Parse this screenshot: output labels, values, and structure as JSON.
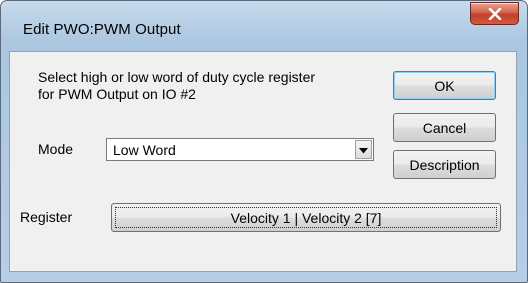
{
  "window": {
    "title": "Edit PWO:PWM Output"
  },
  "dialog": {
    "description_line1": "Select high or low word of duty cycle register",
    "description_line2": "for PWM Output on IO #2",
    "mode_label": "Mode",
    "mode_value": "Low Word",
    "register_label": "Register",
    "register_value": "Velocity 1 | Velocity 2 [7]"
  },
  "buttons": {
    "ok": "OK",
    "cancel": "Cancel",
    "description": "Description"
  },
  "icons": {
    "close": "close-icon",
    "dropdown": "chevron-down-icon"
  },
  "colors": {
    "close_button": "#c9452f",
    "dialog_background": "#f0f0f0",
    "title_bar": "#b9d0e6"
  }
}
